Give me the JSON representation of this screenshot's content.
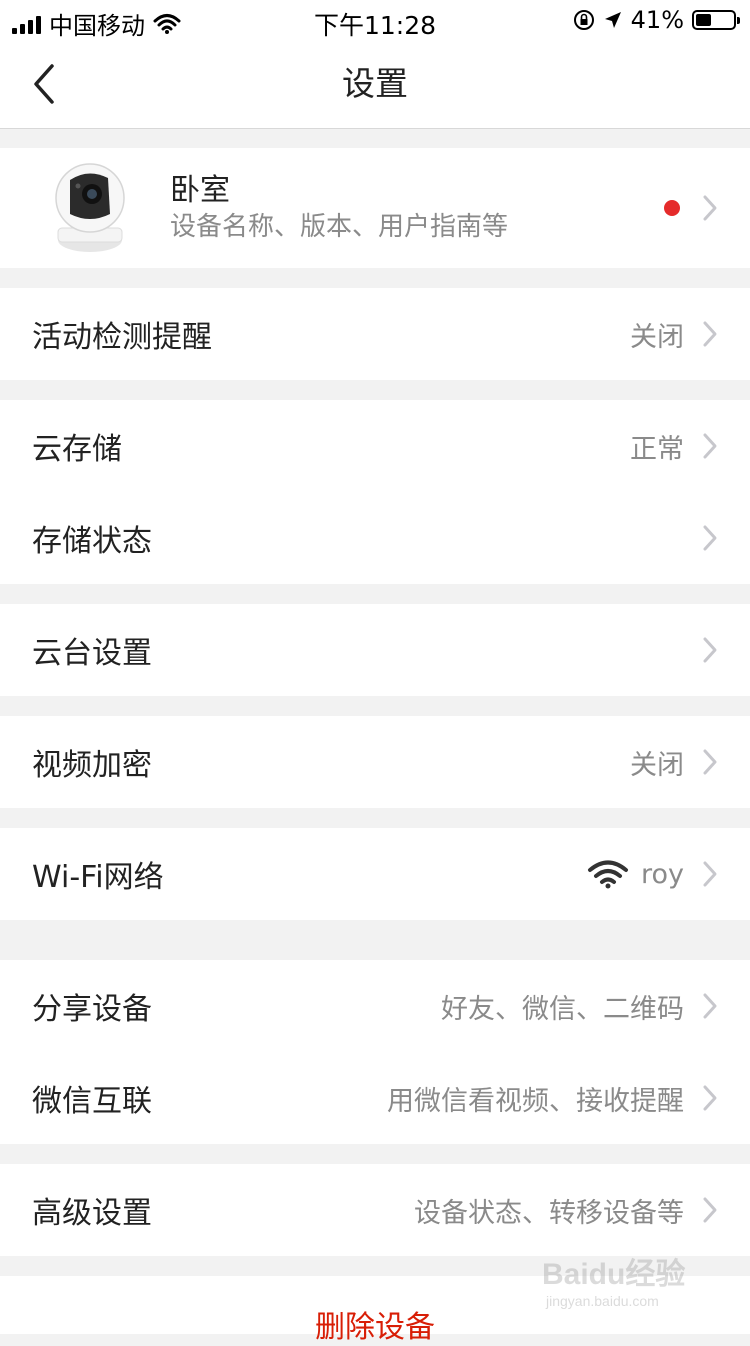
{
  "status_bar": {
    "carrier": "中国移动",
    "time": "下午11:28",
    "battery_text": "41%",
    "battery_level": 0.41
  },
  "nav": {
    "title": "设置"
  },
  "device": {
    "name": "卧室",
    "subtitle": "设备名称、版本、用户指南等"
  },
  "settings": {
    "motion_detection": {
      "label": "活动检测提醒",
      "value": "关闭"
    },
    "cloud_storage": {
      "label": "云存储",
      "value": "正常"
    },
    "storage_status": {
      "label": "存储状态"
    },
    "ptz_settings": {
      "label": "云台设置"
    },
    "video_encryption": {
      "label": "视频加密",
      "value": "关闭"
    },
    "wifi_network": {
      "label": "Wi-Fi网络",
      "value": "roy"
    },
    "share_device": {
      "label": "分享设备",
      "value": "好友、微信、二维码"
    },
    "wechat_link": {
      "label": "微信互联",
      "value": "用微信看视频、接收提醒"
    },
    "advanced_settings": {
      "label": "高级设置",
      "value": "设备状态、转移设备等"
    }
  },
  "delete_label": "删除设备",
  "watermark": {
    "brand": "Baidu经验",
    "url": "jingyan.baidu.com"
  },
  "colors": {
    "accent_red": "#e52b2b",
    "delete_text": "#d81e06",
    "chevron": "#c7c7cc",
    "background": "#f2f2f2"
  },
  "icons": {
    "back": "chevron-left-icon",
    "row_arrow": "chevron-right-icon",
    "wifi_status": "wifi-icon",
    "device_camera": "camera-icon"
  }
}
